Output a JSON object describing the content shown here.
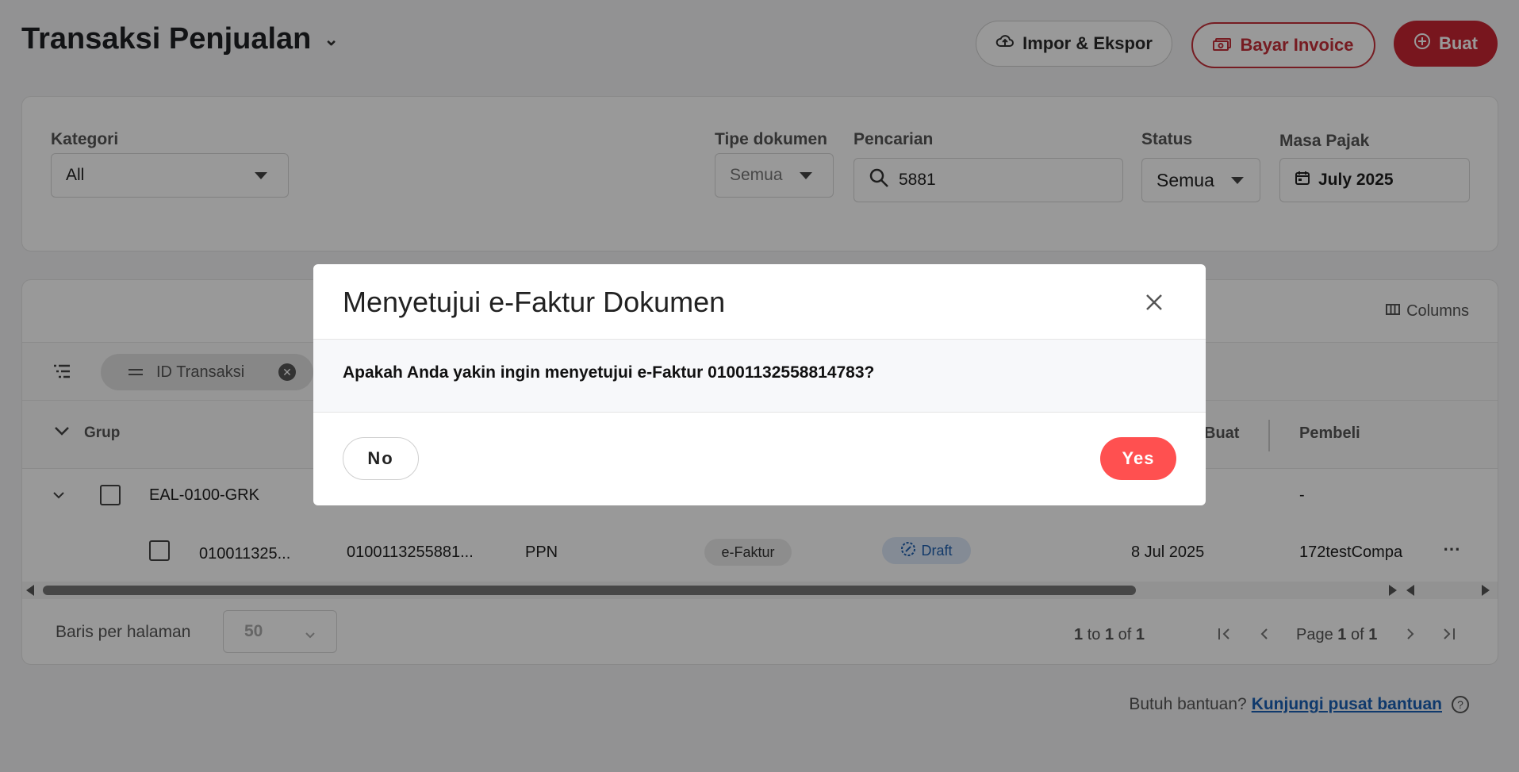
{
  "header": {
    "title": "Transaksi Penjualan",
    "impor_label": "Impor & Ekspor",
    "bayar_label": "Bayar Invoice",
    "buat_label": "Buat"
  },
  "filters": {
    "kategori_label": "Kategori",
    "kategori_value": "All",
    "tipe_label": "Tipe dokumen",
    "tipe_value": "Semua",
    "pencarian_label": "Pencarian",
    "pencarian_value": "5881",
    "status_label": "Status",
    "status_value": "Semua",
    "masa_label": "Masa Pajak",
    "masa_value": "July 2025"
  },
  "table": {
    "columns_label": "Columns",
    "chip_label": "ID Transaksi",
    "grup_label": "Grup",
    "col_buat": "Buat",
    "col_pembeli": "Pembeli",
    "group_row": {
      "name": "EAL-0100-GRK",
      "pembeli": "-"
    },
    "row": {
      "id": "010011325...",
      "nomor": "0100113255881...",
      "jenis": "PPN",
      "tipe": "e-Faktur",
      "status": "Draft",
      "tanggal": "8 Jul 2025",
      "pembeli": "172testCompa"
    }
  },
  "pagination": {
    "rows_label": "Baris per halaman",
    "rows_value": "50",
    "range_from": "1",
    "range_to_word": "to",
    "range_to": "1",
    "range_of_word": "of",
    "range_total": "1",
    "page_word": "Page",
    "page_current": "1",
    "page_of_word": "of",
    "page_total": "1"
  },
  "help": {
    "text": "Butuh bantuan?",
    "link": "Kunjungi pusat bantuan"
  },
  "modal": {
    "title": "Menyetujui e-Faktur Dokumen",
    "message": "Apakah Anda yakin ingin menyetujui e-Faktur 01001132558814783?",
    "no_label": "No",
    "yes_label": "Yes"
  },
  "colors": {
    "brand_red": "#c82632",
    "yes_red": "#ff5050",
    "link_blue": "#1a5fb4"
  }
}
